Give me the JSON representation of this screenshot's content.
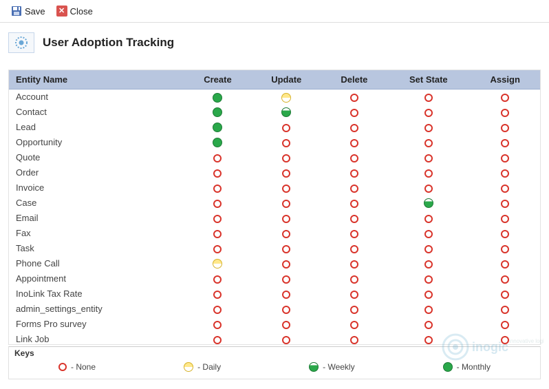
{
  "toolbar": {
    "save_label": "Save",
    "close_label": "Close"
  },
  "page": {
    "title": "User Adoption Tracking"
  },
  "columns": {
    "entity": "Entity Name",
    "create": "Create",
    "update": "Update",
    "delete": "Delete",
    "setstate": "Set State",
    "assign": "Assign"
  },
  "legend": {
    "title": "Keys",
    "none": "- None",
    "daily": "- Daily",
    "weekly": "- Weekly",
    "monthly": "- Monthly"
  },
  "rows": [
    {
      "name": "Account",
      "create": "monthly",
      "update": "daily",
      "delete": "none",
      "setstate": "none",
      "assign": "none"
    },
    {
      "name": "Contact",
      "create": "monthly",
      "update": "weekly",
      "delete": "none",
      "setstate": "none",
      "assign": "none"
    },
    {
      "name": "Lead",
      "create": "monthly",
      "update": "none",
      "delete": "none",
      "setstate": "none",
      "assign": "none"
    },
    {
      "name": "Opportunity",
      "create": "monthly",
      "update": "none",
      "delete": "none",
      "setstate": "none",
      "assign": "none"
    },
    {
      "name": "Quote",
      "create": "none",
      "update": "none",
      "delete": "none",
      "setstate": "none",
      "assign": "none"
    },
    {
      "name": "Order",
      "create": "none",
      "update": "none",
      "delete": "none",
      "setstate": "none",
      "assign": "none"
    },
    {
      "name": "Invoice",
      "create": "none",
      "update": "none",
      "delete": "none",
      "setstate": "none",
      "assign": "none"
    },
    {
      "name": "Case",
      "create": "none",
      "update": "none",
      "delete": "none",
      "setstate": "weekly",
      "assign": "none"
    },
    {
      "name": "Email",
      "create": "none",
      "update": "none",
      "delete": "none",
      "setstate": "none",
      "assign": "none"
    },
    {
      "name": "Fax",
      "create": "none",
      "update": "none",
      "delete": "none",
      "setstate": "none",
      "assign": "none"
    },
    {
      "name": "Task",
      "create": "none",
      "update": "none",
      "delete": "none",
      "setstate": "none",
      "assign": "none"
    },
    {
      "name": "Phone Call",
      "create": "daily",
      "update": "none",
      "delete": "none",
      "setstate": "none",
      "assign": "none"
    },
    {
      "name": "Appointment",
      "create": "none",
      "update": "none",
      "delete": "none",
      "setstate": "none",
      "assign": "none"
    },
    {
      "name": "InoLink Tax Rate",
      "create": "none",
      "update": "none",
      "delete": "none",
      "setstate": "none",
      "assign": "none"
    },
    {
      "name": "admin_settings_entity",
      "create": "none",
      "update": "none",
      "delete": "none",
      "setstate": "none",
      "assign": "none"
    },
    {
      "name": "Forms Pro survey",
      "create": "none",
      "update": "none",
      "delete": "none",
      "setstate": "none",
      "assign": "none"
    },
    {
      "name": "Link Job",
      "create": "none",
      "update": "none",
      "delete": "none",
      "setstate": "none",
      "assign": "none"
    }
  ],
  "watermark": {
    "brand": "inogic",
    "tagline": "innovative logic"
  }
}
